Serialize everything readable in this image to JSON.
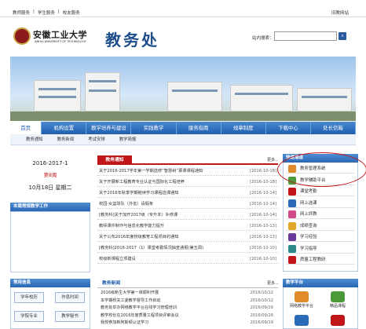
{
  "topbar": {
    "links": [
      "教师服务",
      "|",
      "学生服务",
      "|",
      "校友服务"
    ],
    "old_site": "旧教网站"
  },
  "header": {
    "university": "安徽工业大学",
    "university_en": "ANHUI UNIVERSITY OF TECHNOLOGY",
    "office": "教务处",
    "search_label": "站内搜索："
  },
  "nav": [
    "首页",
    "机构设置",
    "教学培养与建设",
    "实践教学",
    "服务指南",
    "规章制度",
    "下载中心",
    "处长信箱"
  ],
  "subnav": [
    "教务通知",
    "教务新闻",
    "考试安排",
    "教学简报"
  ],
  "date": {
    "term": "2016-2017-1",
    "week": "第8周",
    "date": "10月18日",
    "weekday": "星期二"
  },
  "left_section": "本周常规教学工作",
  "notices": {
    "title": "教务通知",
    "more": "更多...",
    "items": [
      {
        "t": "关于2016-2017学年第一学期选修“智慧树”慕课课程通知",
        "d": "[2016-10-18]"
      },
      {
        "t": "关于开展新工程教育专业认证与国际化工程培养",
        "d": "[2016-10-18]"
      },
      {
        "t": "关于2016年秋季学期继续学习课程选课通知",
        "d": "[2016-10-14]"
      },
      {
        "t": "校园·女篮球队（外省）请假条",
        "d": "[2016-10-14]"
      },
      {
        "t": "[教务科]关于加开2017级（专升本）补修课",
        "d": "[2016-10-14]"
      },
      {
        "t": "教师课件制作与信息化教学能力提升",
        "d": "[2016-10-13]"
      },
      {
        "t": "关于公布2016年度校级教育工程项目的通知",
        "d": "[2016-10-13]"
      },
      {
        "t": "[教务科]2016-2017（1）课堂考勤情况抽查通报(第五周)",
        "d": "[2016-10-10]"
      },
      {
        "t": "校级新课程立项建设",
        "d": "[2016-10-10]"
      }
    ]
  },
  "quick": {
    "title": "快速通道",
    "items": [
      {
        "label": "教务管理系统",
        "color": "#e08a2a"
      },
      {
        "label": "教学辅助平台",
        "color": "#4a9a3a"
      },
      {
        "label": "课堂考勤",
        "color": "#c0161a"
      },
      {
        "label": "网上选课",
        "color": "#2a6ab8"
      },
      {
        "label": "网上評教",
        "color": "#d24a8a"
      },
      {
        "label": "成绩查询",
        "color": "#e2a82a"
      },
      {
        "label": "学习经验",
        "color": "#6a3a9a"
      },
      {
        "label": "学习指导",
        "color": "#2a8a8a"
      },
      {
        "label": "质量工程教研",
        "color": "#c0161a"
      }
    ]
  },
  "common": {
    "title": "常用信息",
    "buttons": [
      "学年校历",
      "作息时间",
      "学院专业",
      "教学秘书"
    ]
  },
  "news": {
    "title": "教务新闻",
    "more": "更多...",
    "items": [
      {
        "t": "2016级新生大学第一课顺利开展",
        "d": "2016/10/12"
      },
      {
        "t": "本学期校关工委教学督导工作启动",
        "d": "2016/10/12"
      },
      {
        "t": "教务处举办网络教学平台在线学习管理培训",
        "d": "2016/09/26"
      },
      {
        "t": "教学校长在2016年度质量工程项目评审会议",
        "d": "2016/09/26"
      },
      {
        "t": "我校参加新阿斯顿认证学习",
        "d": "2016/09/19"
      }
    ]
  },
  "platform": {
    "title": "教学平台",
    "tiles": [
      "网络教学平台",
      "精品课程",
      "",
      ""
    ]
  }
}
